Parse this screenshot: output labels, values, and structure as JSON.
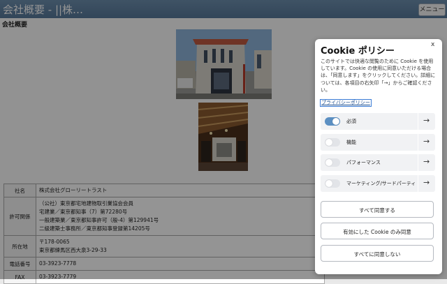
{
  "header": {
    "title": "会社概要 - ||株…",
    "menu_label": "メニュー"
  },
  "page": {
    "section_heading": "会社概要",
    "table": [
      {
        "label": "社名",
        "lines": [
          "株式会社グローリートラスト"
        ]
      },
      {
        "label": "許可関係",
        "lines": [
          "（公社）東京都宅地建物取引業協会会員",
          "宅建業／東京都知事（7）第72280号",
          "一般建築業／東京都知事許可（般-4）第129941号",
          "二級建築士事務所／東京都知事登録第14205号"
        ]
      },
      {
        "label": "所在地",
        "lines": [
          "〒178-0065",
          "東京都練馬区西大泉3-29-33"
        ]
      },
      {
        "label": "電話番号",
        "lines": [
          "03-3923-7778"
        ]
      },
      {
        "label": "FAX",
        "lines": [
          "03-3923-7779"
        ]
      }
    ]
  },
  "cookie": {
    "title": "Cookie ポリシー",
    "close": "x",
    "description": "このサイトでは快適な閲覧のために Cookie を使用しています。Cookie の使用に同意いただける場合は、「同意します」をクリックしてください。詳細については、各項目の右矢印「→」からご確認ください。",
    "privacy_link": "プライバシーポリシー",
    "categories": [
      {
        "label": "必須",
        "enabled": true
      },
      {
        "label": "機能",
        "enabled": false
      },
      {
        "label": "パフォーマンス",
        "enabled": false
      },
      {
        "label": "マーケティング/サードパーティ",
        "enabled": false
      }
    ],
    "arrow_icon": "arrow-right-icon",
    "buttons": {
      "accept_all": "すべて同意する",
      "accept_selected": "有効にした Cookie のみ同意",
      "reject_all": "すべてに同意しない"
    }
  },
  "colors": {
    "header": "#6384a5",
    "toggle_on": "#5b8fc2",
    "link": "#1a4d8f"
  }
}
